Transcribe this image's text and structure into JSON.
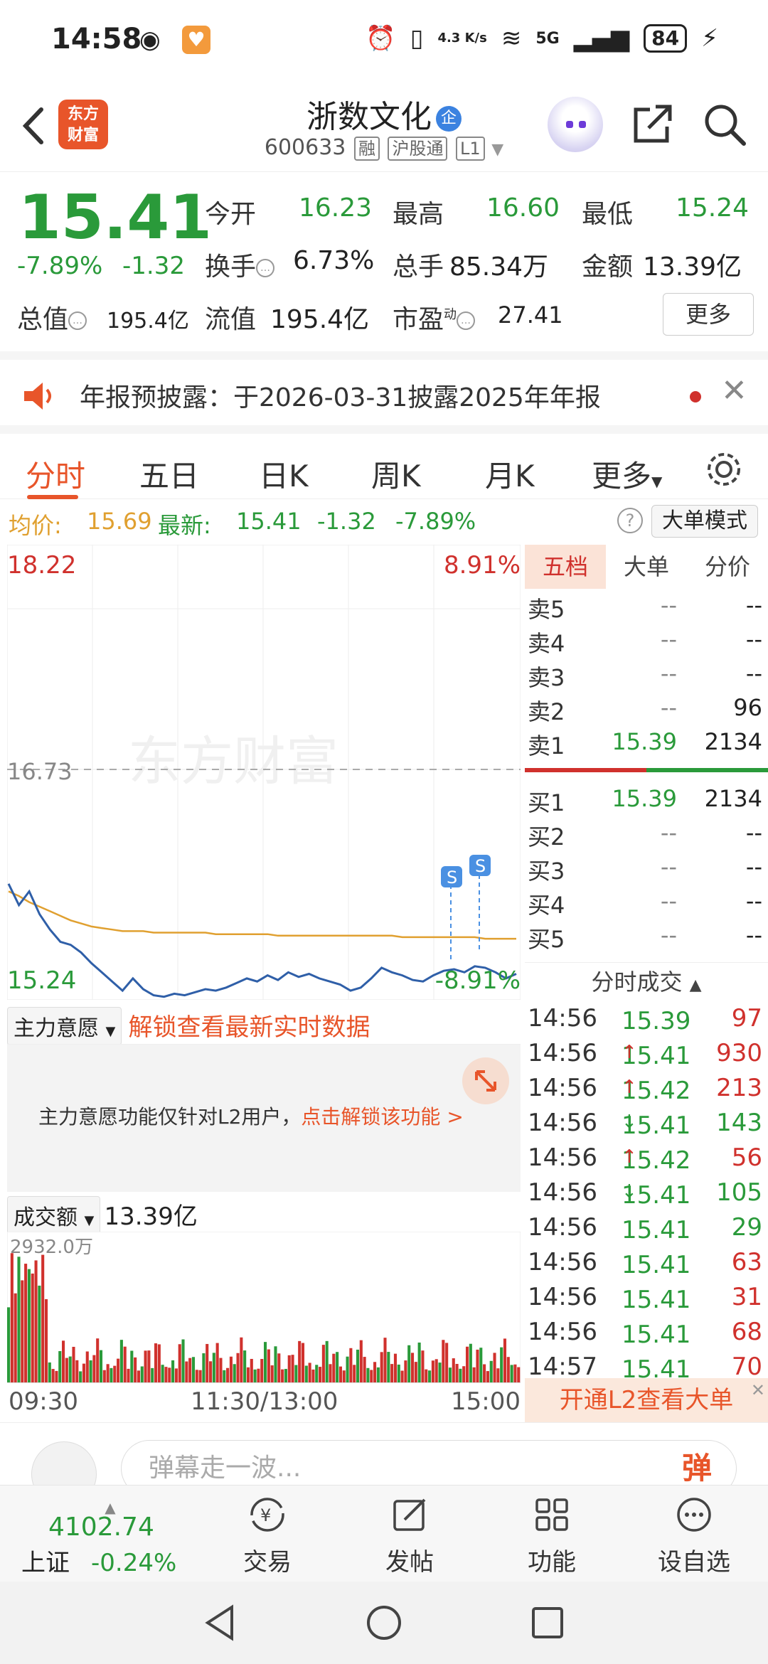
{
  "status_bar": {
    "time": "14:58",
    "net_speed": "4.3 K/s",
    "network": "5G",
    "battery": "84"
  },
  "header": {
    "stock_name": "浙数文化",
    "badge": "企",
    "code": "600633",
    "tags": [
      "融",
      "沪股通",
      "L1"
    ],
    "logo_text_1": "东方",
    "logo_text_2": "财富"
  },
  "quote": {
    "price": "15.41",
    "change_pct": "-7.89%",
    "change": "-1.32",
    "open_label": "今开",
    "open": "16.23",
    "high_label": "最高",
    "high": "16.60",
    "low_label": "最低",
    "low": "15.24",
    "turnover_label": "换手",
    "turnover": "6.73%",
    "volume_label": "总手",
    "volume": "85.34万",
    "amount_label": "金额",
    "amount": "13.39亿",
    "mktcap_label": "总值",
    "mktcap": "195.4亿",
    "float_label": "流值",
    "float_cap": "195.4亿",
    "pe_label": "市盈",
    "pe_sup": "动",
    "pe": "27.41",
    "more_label": "更多"
  },
  "notice": {
    "text": "年报预披露：于2026-03-31披露2025年年报"
  },
  "tabs": [
    "分时",
    "五日",
    "日K",
    "周K",
    "月K",
    "更多"
  ],
  "avg_row": {
    "avg_label": "均价:",
    "avg": "15.69",
    "latest_label": "最新:",
    "latest": "15.41",
    "change": "-1.32",
    "change_pct": "-7.89%",
    "big_order_mode": "大单模式"
  },
  "chart_labels": {
    "top_price": "18.22",
    "top_pct": "8.91%",
    "mid_price": "16.73",
    "bottom_price": "15.24",
    "bottom_pct": "-8.91%",
    "watermark": "东方财富",
    "signal": "S"
  },
  "chart_data": {
    "type": "line",
    "ylim": [
      15.24,
      18.22
    ],
    "prev_close": 16.73,
    "series": [
      {
        "name": "price",
        "values": [
          16.0,
          15.86,
          15.95,
          15.8,
          15.7,
          15.62,
          15.6,
          15.55,
          15.48,
          15.42,
          15.36,
          15.3,
          15.38,
          15.31,
          15.27,
          15.26,
          15.28,
          15.27,
          15.29,
          15.31,
          15.3,
          15.32,
          15.35,
          15.38,
          15.36,
          15.4,
          15.37,
          15.42,
          15.39,
          15.41,
          15.38,
          15.36,
          15.34,
          15.3,
          15.32,
          15.38,
          15.45,
          15.42,
          15.4,
          15.37,
          15.36,
          15.4,
          15.43,
          15.44,
          15.42,
          15.46,
          15.45,
          15.42,
          15.38,
          15.41
        ]
      },
      {
        "name": "avg",
        "values": [
          15.95,
          15.92,
          15.88,
          15.85,
          15.82,
          15.79,
          15.76,
          15.74,
          15.72,
          15.71,
          15.7,
          15.69,
          15.69,
          15.69,
          15.68,
          15.68,
          15.68,
          15.68,
          15.68,
          15.68,
          15.67,
          15.67,
          15.67,
          15.67,
          15.67,
          15.67,
          15.66,
          15.66,
          15.66,
          15.66,
          15.66,
          15.66,
          15.66,
          15.66,
          15.66,
          15.66,
          15.66,
          15.66,
          15.65,
          15.65,
          15.65,
          15.65,
          15.65,
          15.65,
          15.65,
          15.65,
          15.64,
          15.64,
          15.64,
          15.64
        ]
      }
    ]
  },
  "order_book": {
    "tabs": [
      "五档",
      "大单",
      "分价"
    ],
    "sell": [
      {
        "label": "卖5",
        "price": "--",
        "vol": "--"
      },
      {
        "label": "卖4",
        "price": "--",
        "vol": "--"
      },
      {
        "label": "卖3",
        "price": "--",
        "vol": "--"
      },
      {
        "label": "卖2",
        "price": "--",
        "vol": "96"
      },
      {
        "label": "卖1",
        "price": "15.39",
        "vol": "2134"
      }
    ],
    "buy": [
      {
        "label": "买1",
        "price": "15.39",
        "vol": "2134"
      },
      {
        "label": "买2",
        "price": "--",
        "vol": "--"
      },
      {
        "label": "买3",
        "price": "--",
        "vol": "--"
      },
      {
        "label": "买4",
        "price": "--",
        "vol": "--"
      },
      {
        "label": "买5",
        "price": "--",
        "vol": "--"
      }
    ]
  },
  "ticks": {
    "title": "分时成交",
    "rows": [
      {
        "t": "14:56",
        "p": "15.39",
        "v": "97",
        "dir": "",
        "pc": "green",
        "vc": "red"
      },
      {
        "t": "14:56",
        "p": "15.41",
        "v": "930",
        "dir": "↑",
        "pc": "green",
        "vc": "red"
      },
      {
        "t": "14:56",
        "p": "15.42",
        "v": "213",
        "dir": "↑",
        "pc": "green",
        "vc": "red"
      },
      {
        "t": "14:56",
        "p": "15.41",
        "v": "143",
        "dir": "↓",
        "pc": "green",
        "vc": "green"
      },
      {
        "t": "14:56",
        "p": "15.42",
        "v": "56",
        "dir": "↑",
        "pc": "green",
        "vc": "red"
      },
      {
        "t": "14:56",
        "p": "15.41",
        "v": "105",
        "dir": "↓",
        "pc": "green",
        "vc": "green"
      },
      {
        "t": "14:56",
        "p": "15.41",
        "v": "29",
        "dir": "",
        "pc": "green",
        "vc": "green"
      },
      {
        "t": "14:56",
        "p": "15.41",
        "v": "63",
        "dir": "",
        "pc": "green",
        "vc": "red"
      },
      {
        "t": "14:56",
        "p": "15.41",
        "v": "31",
        "dir": "",
        "pc": "green",
        "vc": "red"
      },
      {
        "t": "14:56",
        "p": "15.41",
        "v": "68",
        "dir": "",
        "pc": "green",
        "vc": "red"
      },
      {
        "t": "14:57",
        "p": "15.41",
        "v": "70",
        "dir": "",
        "pc": "green",
        "vc": "red"
      }
    ],
    "unlock_l2": "开通L2查看大单"
  },
  "intent": {
    "dropdown": "主力意愿",
    "unlock_link": "解锁查看最新实时数据",
    "msg": "主力意愿功能仅针对L2用户，",
    "msg_link": "点击解锁该功能 >"
  },
  "volume_panel": {
    "dropdown": "成交额",
    "total": "13.39亿",
    "max_label": "2932.0万"
  },
  "time_axis": {
    "start": "09:30",
    "mid": "11:30/13:00",
    "end": "15:00"
  },
  "danmu": {
    "placeholder": "弹幕走一波...",
    "button": "弹"
  },
  "bottom_nav": {
    "index_value": "4102.74",
    "index_name": "上证",
    "index_change": "-0.24%",
    "items": [
      "交易",
      "发帖",
      "功能",
      "设自选"
    ]
  },
  "colors": {
    "up": "#d0312d",
    "down": "#2a9a3a",
    "accent": "#e8552a",
    "avg_line": "#e0a030",
    "price_line": "#2f5fa8"
  }
}
